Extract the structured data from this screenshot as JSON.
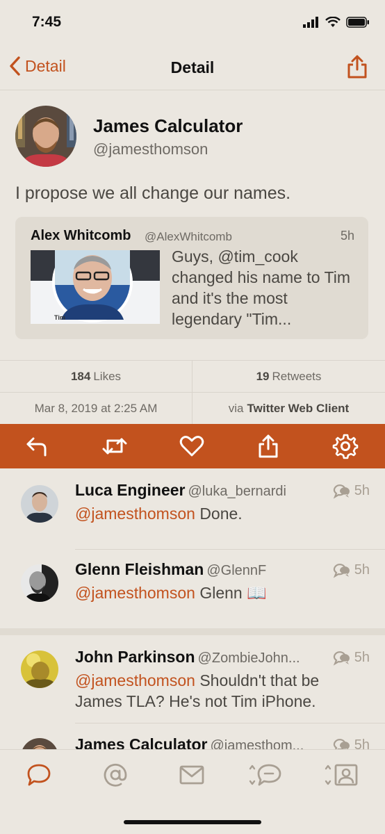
{
  "status_bar": {
    "time": "7:45"
  },
  "nav": {
    "back_label": "Detail",
    "title": "Detail"
  },
  "tweet": {
    "author_name": "James Calculator",
    "author_handle": "@jamesthomson",
    "text": "I propose we all change our names.",
    "quote": {
      "author_name": "Alex Whitcomb",
      "author_handle": "@AlexWhitcomb",
      "time": "5h",
      "text": "Guys, @tim_cook changed his name to Tim  and it's the most legendary \"Tim...",
      "image_caption": "Tim "
    },
    "likes_count": "184",
    "likes_label": "Likes",
    "retweets_count": "19",
    "retweets_label": "Retweets",
    "date": "Mar 8, 2019 at 2:25 AM",
    "via_prefix": "via",
    "client": "Twitter Web Client"
  },
  "actions": [
    "reply-icon",
    "retweet-icon",
    "heart-icon",
    "share-icon",
    "gear-icon"
  ],
  "replies": [
    {
      "name": "Luca Engineer",
      "handle": "@luka_bernardi",
      "time": "5h",
      "mention": "@jamesthomson",
      "text": "Done."
    },
    {
      "name": "Glenn Fleishman",
      "handle": "@GlennF",
      "time": "5h",
      "mention": "@jamesthomson",
      "text": "Glenn 📖"
    },
    {
      "name": "John Parkinson",
      "handle": "@ZombieJohn...",
      "time": "5h",
      "mention": "@jamesthomson",
      "text": "Shouldn't that be James TLA? He's not Tim iPhone."
    },
    {
      "name": "James Calculator",
      "handle": "@jamesthom...",
      "time": "5h",
      "mention": "",
      "text": ""
    }
  ],
  "tabs": [
    "timeline-icon",
    "mentions-icon",
    "messages-icon",
    "activity-icon",
    "profile-icon"
  ],
  "colors": {
    "accent": "#c2521e",
    "background": "#ebe7e0",
    "card": "#e0dbd2"
  }
}
